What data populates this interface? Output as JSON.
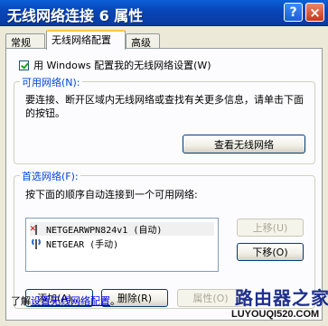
{
  "window": {
    "title": "无线网络连接 6 属性",
    "help_label": "?",
    "close_label": "×"
  },
  "tabs": [
    {
      "label": "常规",
      "active": false
    },
    {
      "label": "无线网络配置",
      "active": true
    },
    {
      "label": "高级",
      "active": false
    }
  ],
  "config": {
    "use_windows_checked": true,
    "use_windows_label": "用 Windows 配置我的无线网络设置(W)"
  },
  "available": {
    "title": "可用网络(N):",
    "description": "要连接、断开区域内无线网络或查找有关更多信息，请单击下面的按钮。",
    "view_button": "查看无线网络"
  },
  "preferred": {
    "title": "首选网络(F):",
    "description": "按下面的顺序自动连接到一个可用网络:",
    "networks": [
      {
        "label": "NETGEARWPN824v1 (自动)",
        "icon": "wireless-disconnected-icon",
        "selected": true
      },
      {
        "label": "NETGEAR (手动)",
        "icon": "wireless-antenna-icon",
        "selected": false
      }
    ],
    "move_up": "上移(U)",
    "move_down": "下移(O)",
    "add": "添加(A)...",
    "remove": "删除(R)",
    "properties": "属性(O)"
  },
  "learn": {
    "prefix": "了解",
    "link": "设置无线网络配置",
    "suffix": "。"
  },
  "watermark": {
    "chinese": "路由器之家",
    "english": "LUYOUQI520.COM"
  }
}
